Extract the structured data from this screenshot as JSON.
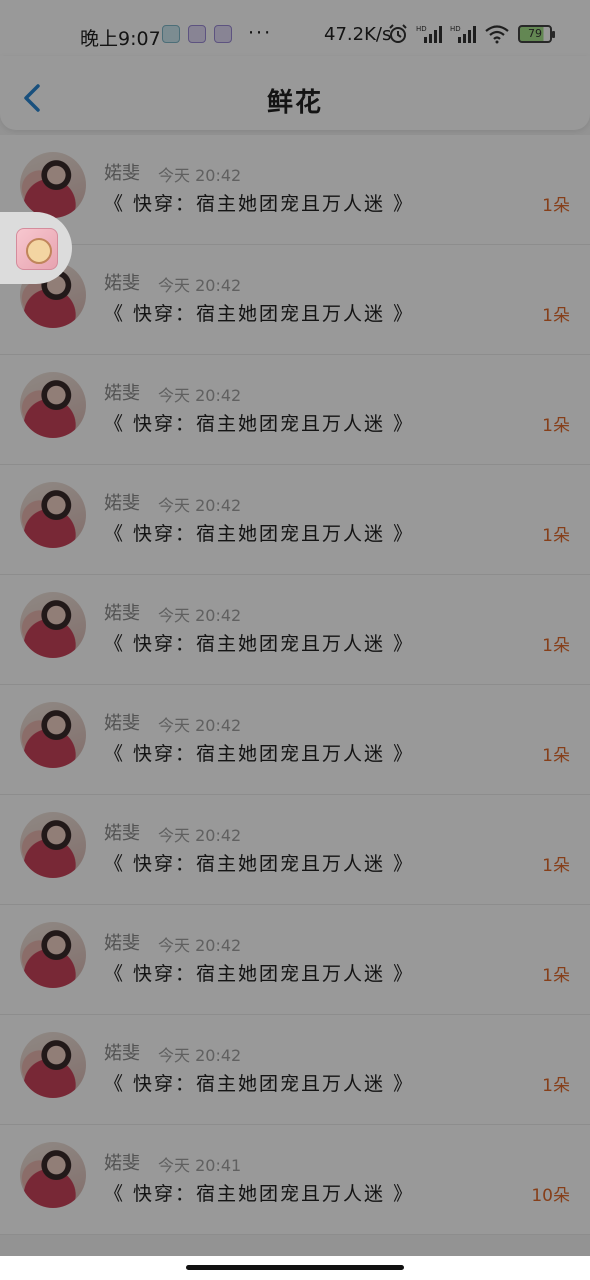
{
  "status_bar": {
    "time": "晚上9:07",
    "dots": "···",
    "speed": "47.2K/s",
    "battery": "79",
    "icons": [
      "alarm-icon",
      "signal-hd-icon",
      "signal-hd-icon",
      "wifi-icon",
      "battery-icon"
    ]
  },
  "nav": {
    "title": "鲜花",
    "back_icon": "chevron-left-icon",
    "accent": "#2a86d1"
  },
  "list": {
    "items": [
      {
        "author": "婼斐",
        "time": "今天 20:42",
        "book": "《 快穿：宿主她团宠且万人迷 》",
        "count": "1朵"
      },
      {
        "author": "婼斐",
        "time": "今天 20:42",
        "book": "《 快穿：宿主她团宠且万人迷 》",
        "count": "1朵"
      },
      {
        "author": "婼斐",
        "time": "今天 20:42",
        "book": "《 快穿：宿主她团宠且万人迷 》",
        "count": "1朵"
      },
      {
        "author": "婼斐",
        "time": "今天 20:42",
        "book": "《 快穿：宿主她团宠且万人迷 》",
        "count": "1朵"
      },
      {
        "author": "婼斐",
        "time": "今天 20:42",
        "book": "《 快穿：宿主她团宠且万人迷 》",
        "count": "1朵"
      },
      {
        "author": "婼斐",
        "time": "今天 20:42",
        "book": "《 快穿：宿主她团宠且万人迷 》",
        "count": "1朵"
      },
      {
        "author": "婼斐",
        "time": "今天 20:42",
        "book": "《 快穿：宿主她团宠且万人迷 》",
        "count": "1朵"
      },
      {
        "author": "婼斐",
        "time": "今天 20:42",
        "book": "《 快穿：宿主她团宠且万人迷 》",
        "count": "1朵"
      },
      {
        "author": "婼斐",
        "time": "今天 20:42",
        "book": "《 快穿：宿主她团宠且万人迷 》",
        "count": "1朵"
      },
      {
        "author": "婼斐",
        "time": "今天 20:41",
        "book": "《 快穿：宿主她团宠且万人迷 》",
        "count": "10朵"
      }
    ]
  },
  "colors": {
    "count_accent": "#e06a2c"
  }
}
